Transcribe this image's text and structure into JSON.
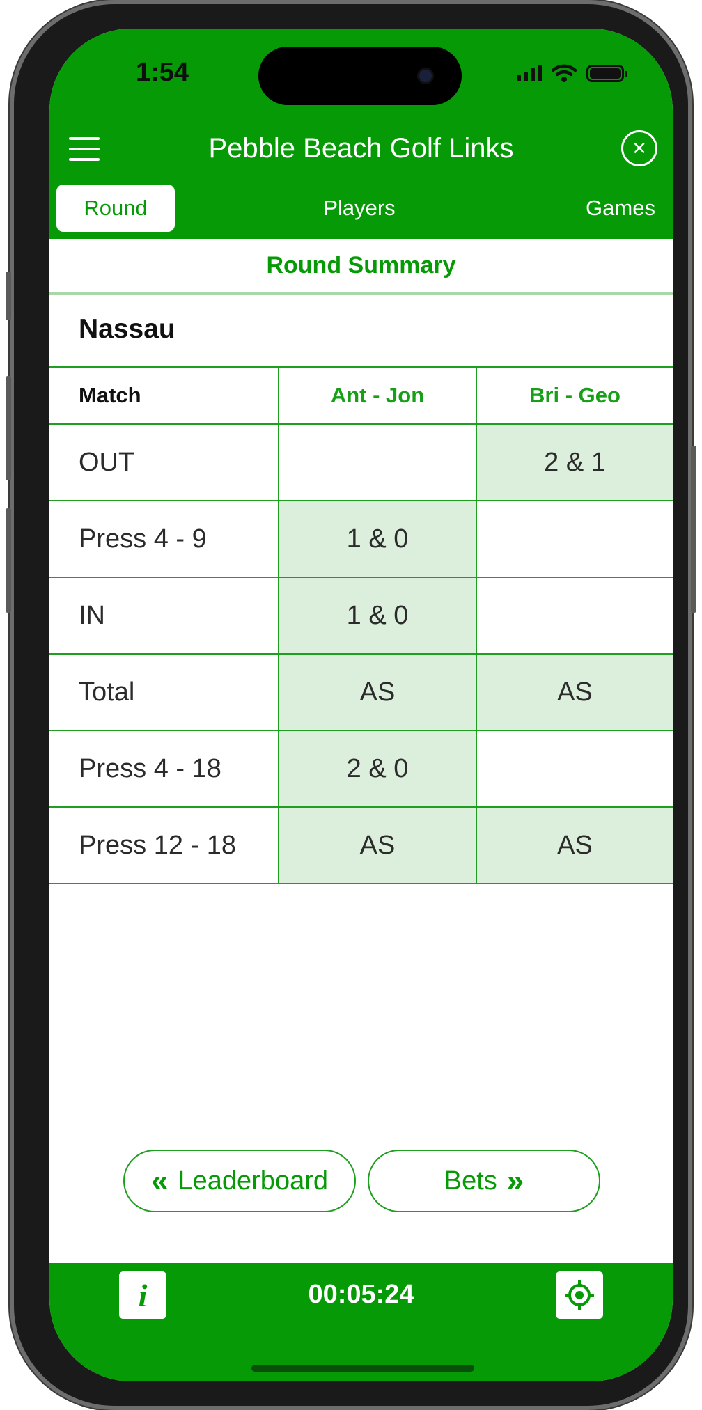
{
  "status_bar": {
    "time": "1:54"
  },
  "header": {
    "title": "Pebble Beach Golf Links"
  },
  "tabs": [
    {
      "label": "Round",
      "active": true
    },
    {
      "label": "Players",
      "active": false
    },
    {
      "label": "Games",
      "active": false
    }
  ],
  "subheader": {
    "title": "Round Summary"
  },
  "game": {
    "name": "Nassau",
    "columns": [
      "Match",
      "Ant - Jon",
      "Bri - Geo"
    ],
    "rows": [
      {
        "label": "OUT",
        "ant_jon": "",
        "bri_geo": "2 & 1"
      },
      {
        "label": "Press 4 - 9",
        "ant_jon": "1 & 0",
        "bri_geo": ""
      },
      {
        "label": "IN",
        "ant_jon": "1 & 0",
        "bri_geo": ""
      },
      {
        "label": "Total",
        "ant_jon": "AS",
        "bri_geo": "AS"
      },
      {
        "label": "Press 4 - 18",
        "ant_jon": "2 & 0",
        "bri_geo": ""
      },
      {
        "label": "Press 12 - 18",
        "ant_jon": "AS",
        "bri_geo": "AS"
      }
    ]
  },
  "buttons": {
    "leaderboard": "Leaderboard",
    "bets": "Bets"
  },
  "footer": {
    "timer": "00:05:24",
    "info_symbol": "i"
  },
  "icons": [
    "menu-icon",
    "close-icon",
    "info-icon",
    "crosshair-icon",
    "chevron-left-double-icon",
    "chevron-right-double-icon"
  ],
  "colors": {
    "brand_green": "#079a07",
    "cell_highlight": "#dcefdc",
    "border_green": "#1f9f1f"
  }
}
